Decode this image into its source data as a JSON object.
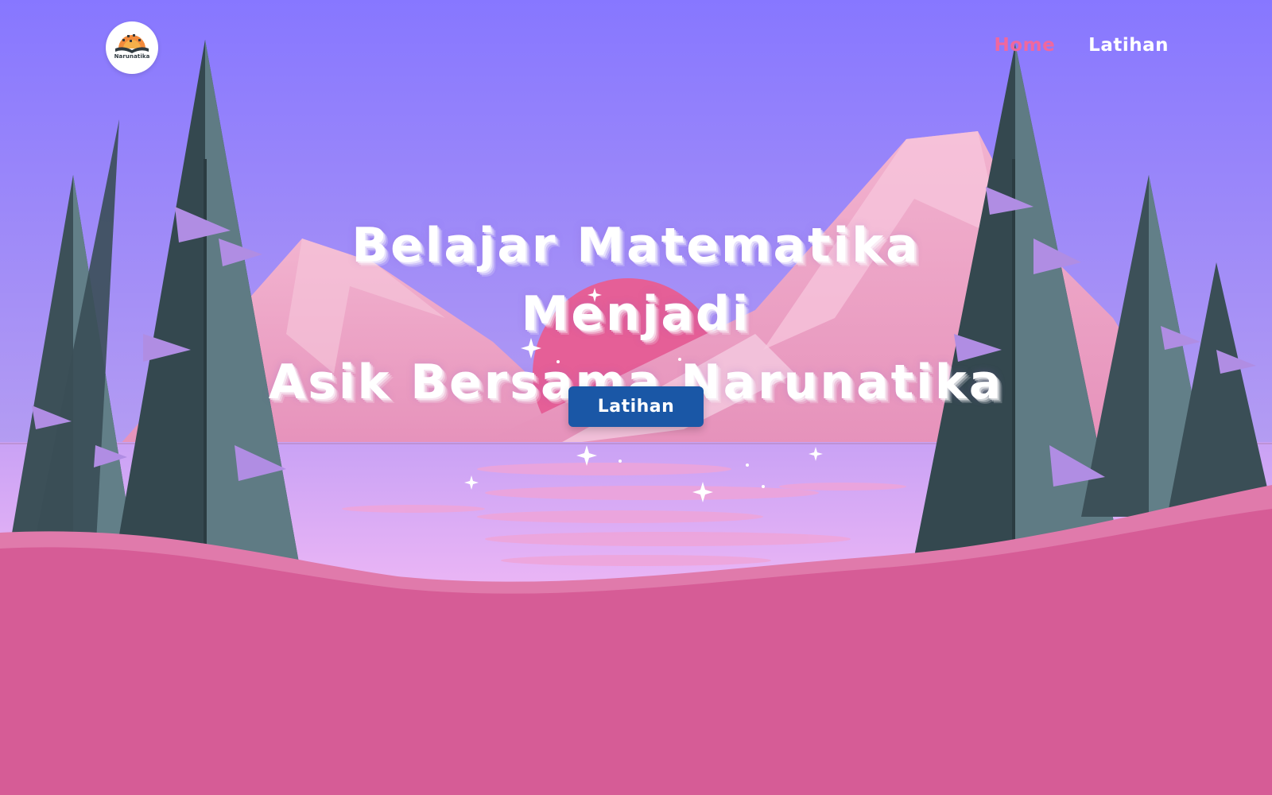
{
  "brand": {
    "logo_text": "Narunatika",
    "logo_icon": "open-book-sunrise-icon"
  },
  "nav": {
    "items": [
      {
        "label": "Home",
        "active": true
      },
      {
        "label": "Latihan",
        "active": false
      }
    ]
  },
  "hero": {
    "title_line1": "Belajar Matematika Menjadi",
    "title_line2": "Asik Bersama Narunatika",
    "button_label": "Latihan"
  },
  "colors": {
    "sky_top": "#8777ff",
    "sky_bottom": "#b49cf2",
    "mountain": "#ee9fc4",
    "sun": "#e55f97",
    "lake": "#dba8f5",
    "ground": "#d65c96",
    "tree_dark": "#34484f",
    "tree_light": "#5f7b84",
    "nav_active": "#f0679e",
    "button": "#1a57a6"
  }
}
